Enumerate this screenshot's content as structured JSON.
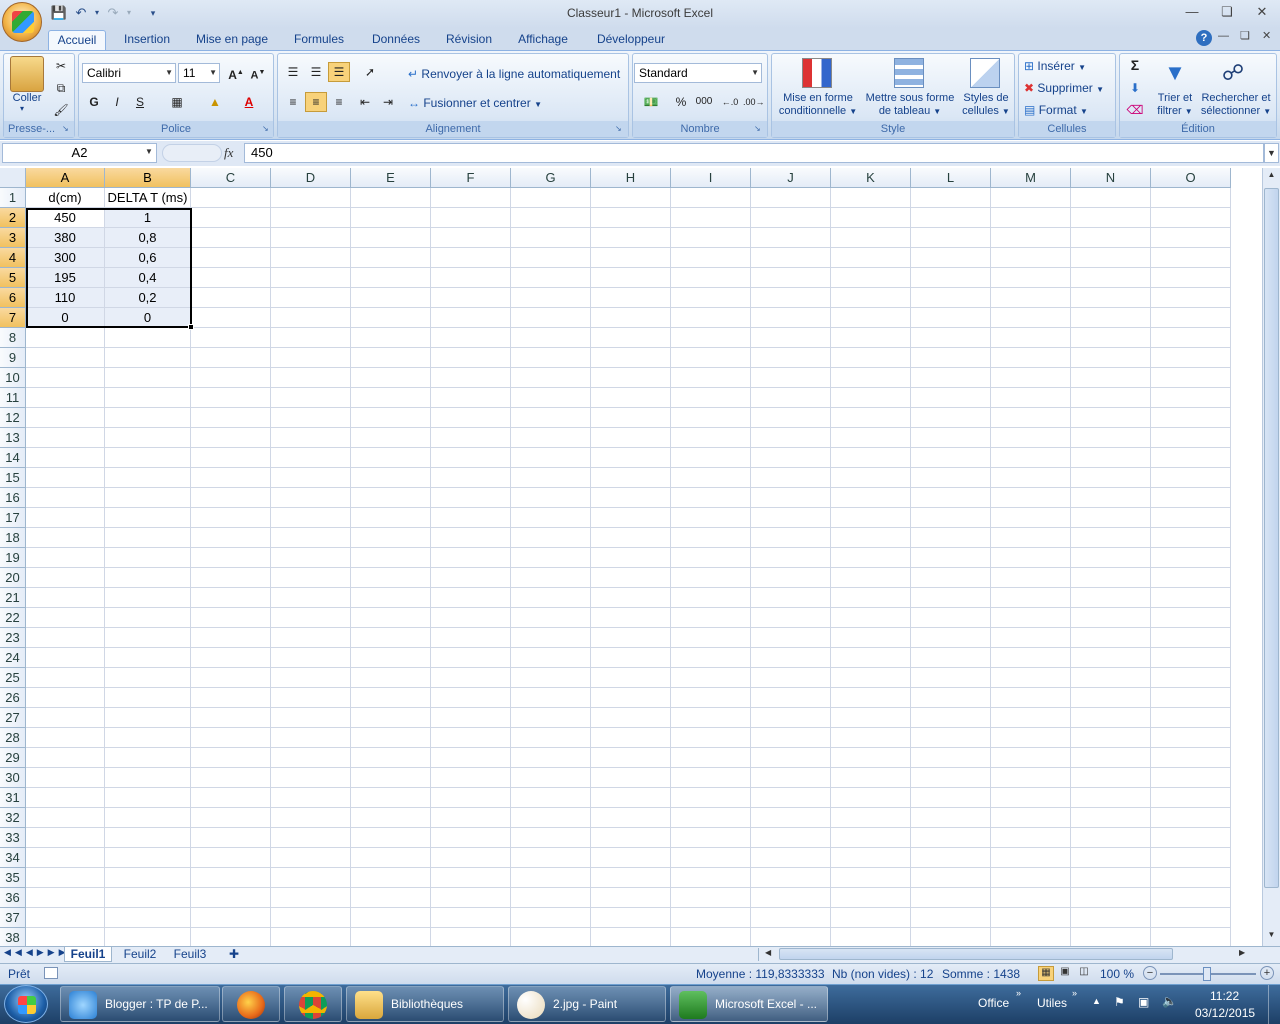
{
  "window": {
    "title": "Classeur1 - Microsoft Excel"
  },
  "qat": {
    "save_icon": "save-icon",
    "undo_icon": "undo-icon",
    "redo_icon": "redo-icon"
  },
  "tabs": [
    "Accueil",
    "Insertion",
    "Mise en page",
    "Formules",
    "Données",
    "Révision",
    "Affichage",
    "Développeur"
  ],
  "ribbon": {
    "clipboard": {
      "paste_label": "Coller",
      "group_label": "Presse-..."
    },
    "font": {
      "font_name": "Calibri",
      "font_size": "11",
      "bold": "G",
      "italic": "I",
      "underline": "S",
      "group_label": "Police"
    },
    "alignment": {
      "wrap_label": "Renvoyer à la ligne automatiquement",
      "merge_label": "Fusionner et centrer",
      "group_label": "Alignement"
    },
    "number": {
      "format": "Standard",
      "percent": "%",
      "thousands": "000",
      "group_label": "Nombre"
    },
    "style": {
      "cond_format_1": "Mise en forme",
      "cond_format_2": "conditionnelle",
      "table_1": "Mettre sous forme",
      "table_2": "de tableau",
      "cell_styles_1": "Styles de",
      "cell_styles_2": "cellules",
      "group_label": "Style"
    },
    "cells": {
      "insert_label": "Insérer",
      "delete_label": "Supprimer",
      "format_label": "Format",
      "group_label": "Cellules"
    },
    "editing": {
      "sigma": "Σ",
      "sort_1": "Trier et",
      "sort_2": "filtrer",
      "find_1": "Rechercher et",
      "find_2": "sélectionner",
      "group_label": "Édition"
    }
  },
  "formula_bar": {
    "name_box": "A2",
    "fx": "fx",
    "value": "450"
  },
  "columns": [
    "A",
    "B",
    "C",
    "D",
    "E",
    "F",
    "G",
    "H",
    "I",
    "J",
    "K",
    "L",
    "M",
    "N",
    "O"
  ],
  "rows": [
    "1",
    "2",
    "3",
    "4",
    "5",
    "6",
    "7",
    "8",
    "9",
    "10",
    "11",
    "12",
    "13",
    "14",
    "15",
    "16",
    "17",
    "18",
    "19",
    "20",
    "21",
    "22",
    "23",
    "24",
    "25",
    "26",
    "27",
    "28",
    "29",
    "30",
    "31",
    "32",
    "33",
    "34",
    "35",
    "36",
    "37",
    "38"
  ],
  "cells": {
    "A1": "d(cm)",
    "B1": "DELTA T (ms)",
    "A2": "450",
    "B2": "1",
    "A3": "380",
    "B3": "0,8",
    "A4": "300",
    "B4": "0,6",
    "A5": "195",
    "B5": "0,4",
    "A6": "110",
    "B6": "0,2",
    "A7": "0",
    "B7": "0"
  },
  "sheets": [
    "Feuil1",
    "Feuil2",
    "Feuil3"
  ],
  "status": {
    "ready": "Prêt",
    "average": "Moyenne : 119,8333333",
    "count": "Nb (non vides) : 12",
    "sum": "Somme : 1438",
    "zoom": "100 %"
  },
  "taskbar": {
    "items": [
      {
        "label": "Blogger : TP de P...",
        "icon": "ie-icon"
      },
      {
        "label": "",
        "icon": "firefox-icon"
      },
      {
        "label": "",
        "icon": "chrome-icon"
      },
      {
        "label": "Bibliothèques",
        "icon": "folder-icon"
      },
      {
        "label": "2.jpg - Paint",
        "icon": "paint-icon"
      },
      {
        "label": "Microsoft Excel - ...",
        "icon": "excel-icon"
      }
    ],
    "toolbar_office": "Office",
    "toolbar_utiles": "Utiles",
    "time": "11:22",
    "date": "03/12/2015"
  }
}
